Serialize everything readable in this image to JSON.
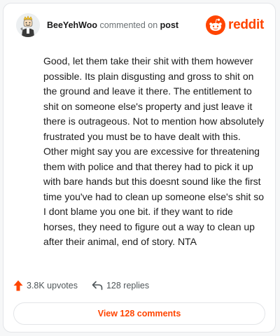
{
  "header": {
    "username": "BeeYehWoo",
    "action_text": "commented on",
    "post_link": "post",
    "brand_name": "reddit"
  },
  "comment": {
    "text": "Good, let them take their shit with them however possible. Its plain disgusting and gross to shit on the ground and leave it there. The entitlement to shit on someone else's property and just leave it there is outrageous. Not to mention how absolutely frustrated you must be to have dealt with this. Other might say you are excessive for threatening them with police and that therey had to pick it up with bare hands but this doesnt sound like the first time you've had to clean up someone else's shit so I dont blame you one bit. if they want to ride horses, they need to figure out a way to clean up after their animal, end of story. NTA"
  },
  "stats": {
    "upvotes": "3.8K upvotes",
    "replies": "128 replies"
  },
  "footer": {
    "view_comments_label": "View 128 comments"
  },
  "icons": {
    "upvote": "upvote-arrow-icon",
    "reply": "reply-arrow-icon",
    "logo": "reddit-snoo-icon"
  },
  "colors": {
    "brand": "#ff4500",
    "text": "#1c1c1c",
    "muted": "#6b7174",
    "border": "#e3e5e8"
  }
}
